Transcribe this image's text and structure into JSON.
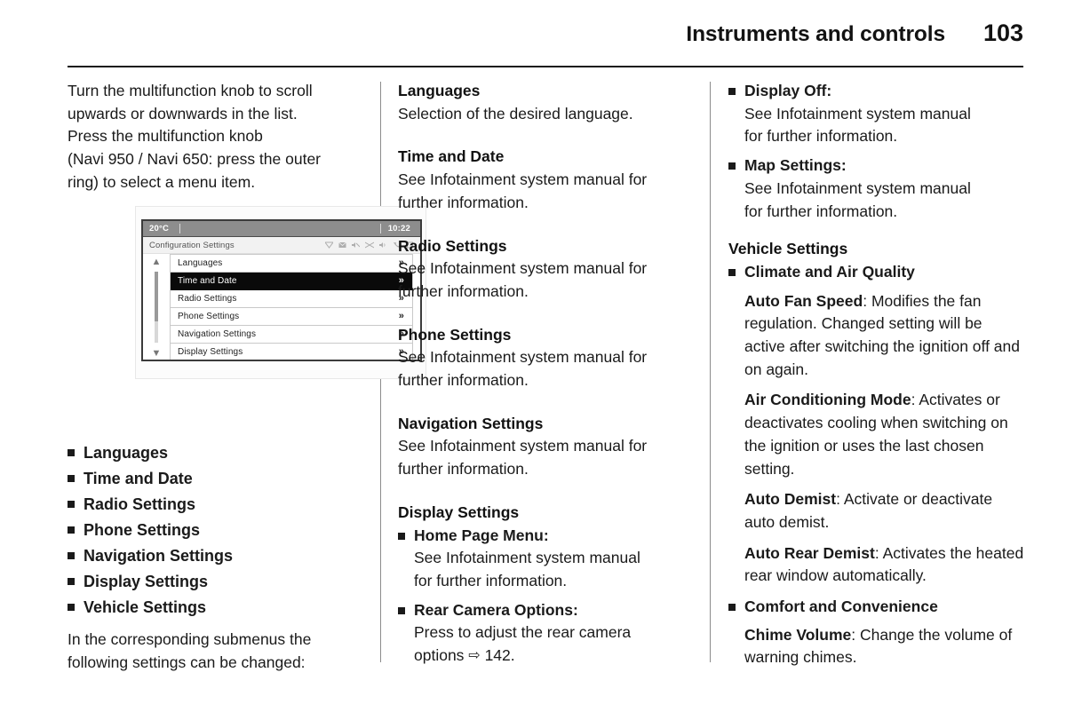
{
  "header": {
    "title": "Instruments and controls",
    "page_number": "103"
  },
  "column1": {
    "intro_lines": [
      "Turn the multifunction knob to scroll",
      "upwards or downwards in the list.",
      "Press the multifunction knob",
      "(Navi 950 / Navi 650: press the outer",
      "ring) to select a menu item."
    ],
    "infotainment": {
      "status_bar": {
        "temperature": "20°C",
        "clock": "10:22"
      },
      "menu_title": "Configuration Settings",
      "status_icons": [
        "wifi-signal-icon",
        "message-icon",
        "mute-icon",
        "shuffle-icon",
        "speaker-icon",
        "phone-icon",
        "battery-icon"
      ],
      "scroll_up": "▲",
      "scroll_down": "▼",
      "items": [
        {
          "label": "Languages",
          "selected": false,
          "arrow": "»"
        },
        {
          "label": "Time and Date",
          "selected": true,
          "arrow": "»"
        },
        {
          "label": "Radio Settings",
          "selected": false,
          "arrow": "»"
        },
        {
          "label": "Phone Settings",
          "selected": false,
          "arrow": "»"
        },
        {
          "label": "Navigation Settings",
          "selected": false,
          "arrow": "»"
        },
        {
          "label": "Display Settings",
          "selected": false,
          "arrow": "»"
        }
      ]
    },
    "menu_list": [
      "Languages",
      "Time and Date",
      "Radio Settings",
      "Phone Settings",
      "Navigation Settings",
      "Display Settings",
      "Vehicle Settings"
    ],
    "closing_lines": [
      "In the corresponding submenus the",
      "following settings can be changed:"
    ]
  },
  "column2": {
    "sections": [
      {
        "heading": "Languages",
        "body_lines": [
          "Selection of the desired language."
        ]
      },
      {
        "heading": "Time and Date",
        "body_lines": [
          "See Infotainment system manual for",
          "further information."
        ]
      },
      {
        "heading": "Radio Settings",
        "body_lines": [
          "See Infotainment system manual for",
          "further information."
        ]
      },
      {
        "heading": "Phone Settings",
        "body_lines": [
          "See Infotainment system manual for",
          "further information."
        ]
      },
      {
        "heading": "Navigation Settings",
        "body_lines": [
          "See Infotainment system manual for",
          "further information."
        ]
      }
    ],
    "display_settings": {
      "heading": "Display Settings",
      "items": [
        {
          "label": "Home Page Menu",
          "label_suffix": ":",
          "body_lines": [
            "See Infotainment system manual",
            "for further information."
          ]
        },
        {
          "label": "Rear Camera Options",
          "label_suffix": ":",
          "body_lines": [
            "Press to adjust the rear camera",
            "options "
          ],
          "arrow": "⇨",
          "reference": " 142."
        }
      ]
    }
  },
  "column3": {
    "display_items": [
      {
        "label": "Display Off",
        "label_suffix": ":",
        "body_lines": [
          "See Infotainment system manual",
          "for further information."
        ]
      },
      {
        "label": "Map Settings",
        "label_suffix": ":",
        "body_lines": [
          "See Infotainment system manual",
          "for further information."
        ]
      }
    ],
    "vehicle_settings": {
      "heading": "Vehicle Settings",
      "groups": [
        {
          "label": "Climate and Air Quality",
          "entries": [
            {
              "term": "Auto Fan Speed",
              "separator": ": ",
              "description": "Modifies the fan regulation. Changed setting will be active after switching the ignition off and on again."
            },
            {
              "term": "Air Conditioning Mode",
              "separator": ": ",
              "description": "Activates or deactivates cooling when switching on the ignition or uses the last chosen setting."
            },
            {
              "term": "Auto Demist",
              "separator": ": ",
              "description": "Activate or deactivate auto demist."
            },
            {
              "term": "Auto Rear Demist",
              "separator": ": ",
              "description": "Activates the heated rear window automatically."
            }
          ]
        },
        {
          "label": "Comfort and Convenience",
          "entries": [
            {
              "term": "Chime Volume",
              "separator": ": ",
              "description": "Change the volume of warning chimes."
            }
          ]
        }
      ]
    }
  }
}
